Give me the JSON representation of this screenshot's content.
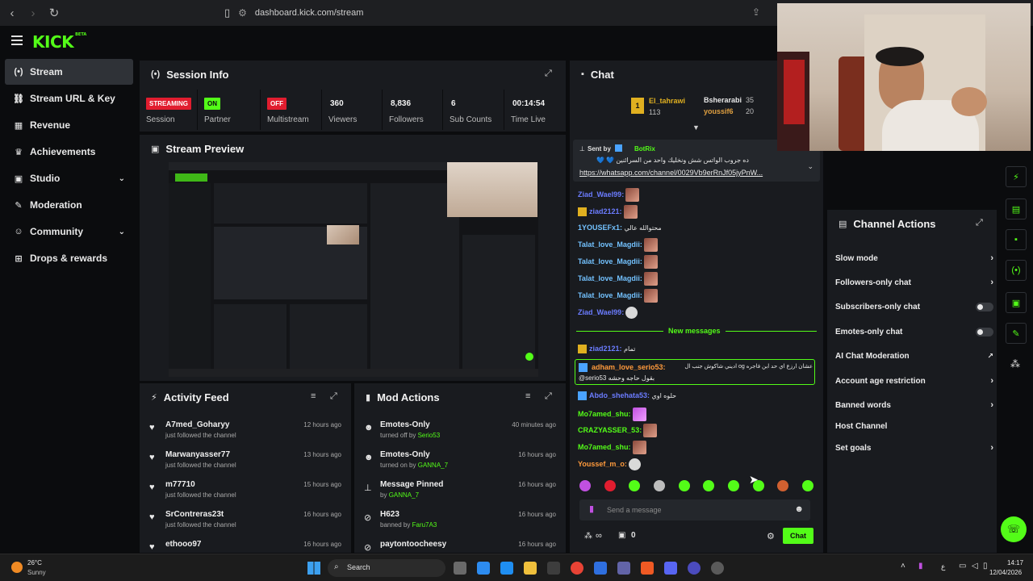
{
  "browser": {
    "url": "dashboard.kick.com/stream"
  },
  "brand": {
    "logo": "KICK",
    "beta": "BETA"
  },
  "sidebar": {
    "items": [
      {
        "label": "Stream",
        "icon": "broadcast-icon"
      },
      {
        "label": "Stream URL & Key",
        "icon": "link-icon"
      },
      {
        "label": "Revenue",
        "icon": "revenue-icon"
      },
      {
        "label": "Achievements",
        "icon": "trophy-icon"
      },
      {
        "label": "Studio",
        "icon": "studio-icon"
      },
      {
        "label": "Moderation",
        "icon": "wrench-icon"
      },
      {
        "label": "Community",
        "icon": "community-icon"
      },
      {
        "label": "Drops & rewards",
        "icon": "gift-icon"
      }
    ]
  },
  "session": {
    "title": "Session Info",
    "session_badge": "STREAMING",
    "session_label": "Session",
    "partner_badge": "ON",
    "partner_label": "Partner",
    "multistream_badge": "OFF",
    "multistream_label": "Multistream",
    "viewers": "360",
    "viewers_label": "Viewers",
    "followers": "8,836",
    "followers_label": "Followers",
    "subs": "6",
    "subs_label": "Sub Counts",
    "time": "00:14:54",
    "time_label": "Time Live"
  },
  "preview": {
    "title": "Stream Preview"
  },
  "activity": {
    "title": "Activity Feed",
    "items": [
      {
        "name": "A7med_Goharyy",
        "sub": "just followed the channel",
        "time": "12 hours ago"
      },
      {
        "name": "Marwanyasser77",
        "sub": "just followed the channel",
        "time": "13 hours ago"
      },
      {
        "name": "m77710",
        "sub": "just followed the channel",
        "time": "15 hours ago"
      },
      {
        "name": "SrContreras23t",
        "sub": "just followed the channel",
        "time": "16 hours ago"
      },
      {
        "name": "ethooo97",
        "sub": "",
        "time": "16 hours ago"
      }
    ]
  },
  "modactions": {
    "title": "Mod Actions",
    "items": [
      {
        "name": "Emotes-Only",
        "pre": "turned off by",
        "who": "Serio53",
        "time": "40 minutes ago",
        "icon": "emote-icon"
      },
      {
        "name": "Emotes-Only",
        "pre": "turned on by",
        "who": "GANNA_7",
        "time": "16 hours ago",
        "icon": "emote-icon"
      },
      {
        "name": "Message Pinned",
        "pre": "by",
        "who": "GANNA_7",
        "time": "16 hours ago",
        "icon": "pin-icon"
      },
      {
        "name": "H623",
        "pre": "banned by",
        "who": "Faru7A3",
        "time": "16 hours ago",
        "icon": "ban-icon"
      },
      {
        "name": "paytontoocheesy",
        "pre": "",
        "who": "",
        "time": "16 hours ago",
        "icon": "ban-icon"
      }
    ]
  },
  "chat": {
    "title": "Chat",
    "leader1": {
      "rank": "1",
      "name": "El_tahrawi",
      "score": "113"
    },
    "leader2": {
      "name": "Bsherarabi",
      "score": "35"
    },
    "leader3": {
      "name": "youssif6",
      "score": "20"
    },
    "pinned_by": "Sent by",
    "pinned_user": "BotRix",
    "pinned_text": "ده جروب الواتس شش ونخليك واحد من السرائنين 💙 💙",
    "pinned_link": "https://whatsapp.com/channel/0029Vb9erRnJf05jyPnW...",
    "new_messages": "New messages",
    "messages": [
      {
        "user": "Ziad_Wael99:",
        "text": "",
        "color": "#6b7cff"
      },
      {
        "user": "ziad2121:",
        "text": "",
        "color": "#6b7cff"
      },
      {
        "user": "1YOUSEFx1:",
        "text": "محتوالله عالي",
        "color": "#73c2ff"
      },
      {
        "user": "Talat_love_Magdii:",
        "text": "",
        "color": "#73c2ff"
      },
      {
        "user": "Talat_love_Magdii:",
        "text": "",
        "color": "#73c2ff"
      },
      {
        "user": "Talat_love_Magdii:",
        "text": "",
        "color": "#73c2ff"
      },
      {
        "user": "Talat_love_Magdii:",
        "text": "",
        "color": "#73c2ff"
      },
      {
        "user": "Ziad_Wael99:",
        "text": "",
        "color": "#6b7cff"
      },
      {
        "user": "ziad2121:",
        "text": "تمام",
        "color": "#6b7cff"
      },
      {
        "user": "adham_love_serio53:",
        "text": "عشان ارزع اي حد ابن فاجره og اديني شاكوش جنب ال",
        "color": "#ff9a3c"
      },
      {
        "user": "",
        "text": "@serio53 بقول حاجه وحشه",
        "color": "#ff9a3c"
      },
      {
        "user": "Abdo_shehata53:",
        "text": "حلوه اوي",
        "color": "#6b7cff"
      },
      {
        "user": "Mo7amed_shu:",
        "text": "",
        "color": "#53fc18"
      },
      {
        "user": "CRAZYASSER_53:",
        "text": "",
        "color": "#53fc18"
      },
      {
        "user": "Mo7amed_shu:",
        "text": "",
        "color": "#53fc18"
      },
      {
        "user": "Youssef_m_o:",
        "text": "",
        "color": "#ff9a3c"
      }
    ],
    "input_placeholder": "Send a message",
    "points": "∞",
    "count": "0",
    "send_label": "Chat"
  },
  "channel_actions": {
    "title": "Channel Actions",
    "items": [
      {
        "label": "Slow mode",
        "control": "arrow"
      },
      {
        "label": "Followers-only chat",
        "control": "arrow"
      },
      {
        "label": "Subscribers-only chat",
        "control": "toggle"
      },
      {
        "label": "Emotes-only chat",
        "control": "toggle"
      },
      {
        "label": "AI Chat Moderation",
        "control": "external"
      },
      {
        "label": "Account age restriction",
        "control": "arrow"
      },
      {
        "label": "Banned words",
        "control": "arrow"
      },
      {
        "label": "Host Channel",
        "control": "none"
      },
      {
        "label": "Set goals",
        "control": "arrow"
      }
    ]
  },
  "taskbar": {
    "weather_temp": "26°C",
    "weather_desc": "Sunny",
    "search": "Search",
    "time": "14:17",
    "date": "12/04/2026",
    "lang": "ع"
  },
  "colors": {
    "accent": "#53fc18",
    "panel": "#191b1f",
    "bg": "#0b0c0e",
    "red": "#e11d2f"
  }
}
